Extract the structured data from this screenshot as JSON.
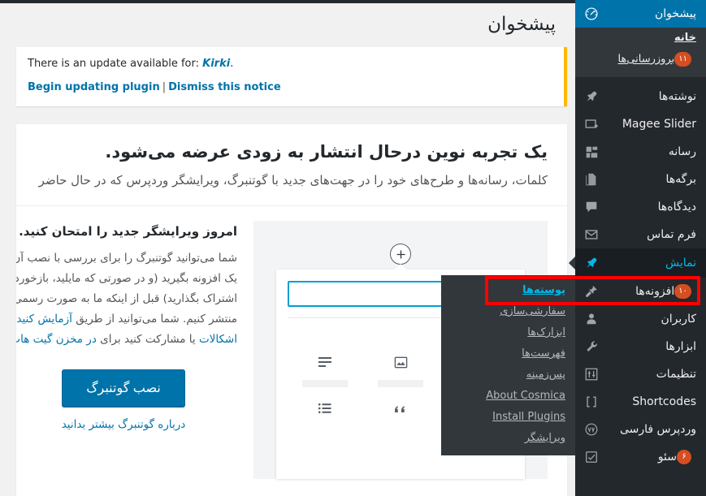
{
  "page": {
    "title": "پیشخوان",
    "language": "fa"
  },
  "colors": {
    "sidebar_bg": "#23282d",
    "submenu_bg": "#32373c",
    "accent_blue": "#0073aa",
    "link_blue": "#00b9eb",
    "badge_orange": "#d54e21",
    "notice_border": "#ffb900",
    "annotation_red": "#fe0000",
    "page_bg": "#f1f1f1"
  },
  "notice": {
    "message_prefix": "There is an update available for:",
    "plugin_name": "Kirki",
    "message_suffix": ".",
    "update_link": "Begin updating plugin",
    "separator": "|",
    "dismiss_link": "Dismiss this notice"
  },
  "panel": {
    "heading": "یک تجربه نوین درحال انتشار به زودی عرضه می‌شود.",
    "subheading": "کلمات، رسانه‌ها و طرح‌های خود را در جهت‌های جدید با گوتنبرگ، ویرایشگر وردپرس که در حال حاضر ",
    "column_title": "امروز ویرایشگر جدید را امتحان کنید.",
    "body_line1": "شما می‌توانید گوتنبرگ را برای بررسی با نصب آن",
    "body_line2": "یک افزونه بگیرید (و در صورتی که مایلید، بازخورد خ",
    "body_line3": "اشتراک بگذارید) قبل از اینکه ما به صورت رسمی آ",
    "body_line4_pre": "منتشر کنیم. شما می‌توانید از طریق ",
    "body_line4_link": "آزمایش کنید",
    "body_line5_link_a": "اشکالات",
    "body_line5_mid": " یا مشارکت کنید برای ",
    "body_line5_link_b": "در مخزن گیت هاب",
    "install_button": "نصب گوتنبرگ",
    "learn_more_link": "درباره گوتنبرگ بیشتر بدانید"
  },
  "illustration": {
    "add_block_icon": "plus-icon",
    "search_placeholder_bar": "",
    "section_title_bar": "",
    "blocks": [
      {
        "icon": "image-block-icon"
      },
      {
        "icon": "paragraph-block-icon"
      },
      {
        "icon": "third-block-icon"
      },
      {
        "icon": "quote-block-icon"
      },
      {
        "icon": "list-block-icon"
      },
      {
        "icon": "sixth-block-icon"
      }
    ]
  },
  "sidebar": {
    "dashboard": {
      "label": "پیشخوان",
      "icon": "dashboard-icon",
      "submenu": [
        {
          "label": "خانه",
          "badge": null
        },
        {
          "label": "بروزرسانی‌ها",
          "badge": "۱۱"
        }
      ]
    },
    "items": [
      {
        "label": "نوشته‌ها",
        "icon": "pin-icon",
        "badge": null,
        "state": "normal"
      },
      {
        "label": "Magee Slider",
        "icon": "slider-icon",
        "badge": null,
        "state": "normal"
      },
      {
        "label": "رسانه",
        "icon": "media-icon",
        "badge": null,
        "state": "normal"
      },
      {
        "label": "برگه‌ها",
        "icon": "pages-icon",
        "badge": null,
        "state": "normal"
      },
      {
        "label": "دیدگاه‌ها",
        "icon": "comments-icon",
        "badge": null,
        "state": "normal"
      },
      {
        "label": "فرم تماس",
        "icon": "mail-icon",
        "badge": null,
        "state": "normal"
      },
      {
        "label": "نمایش",
        "icon": "appearance-icon",
        "badge": null,
        "state": "open"
      },
      {
        "label": "افزونه‌ها",
        "icon": "plugins-icon",
        "badge": "۱۰",
        "state": "normal"
      },
      {
        "label": "کاربران",
        "icon": "users-icon",
        "badge": null,
        "state": "normal"
      },
      {
        "label": "ابزارها",
        "icon": "tools-icon",
        "badge": null,
        "state": "normal"
      },
      {
        "label": "تنظیمات",
        "icon": "settings-icon",
        "badge": null,
        "state": "normal"
      },
      {
        "label": "Shortcodes",
        "icon": "shortcodes-icon",
        "badge": null,
        "state": "normal"
      },
      {
        "label": "وردپرس فارسی",
        "icon": "wp-persian-icon",
        "badge": null,
        "state": "normal"
      },
      {
        "label": "سئو",
        "icon": "seo-icon",
        "badge": "۶",
        "state": "normal"
      }
    ]
  },
  "flyout": {
    "items": [
      {
        "label": "پوسته‌ها",
        "current": true
      },
      {
        "label": "سفارشی‌سازی",
        "current": false
      },
      {
        "label": "ابزارک‌ها",
        "current": false
      },
      {
        "label": "فهرست‌ها",
        "current": false
      },
      {
        "label": "پس‌زمینه",
        "current": false
      },
      {
        "label": "About Cosmica",
        "current": false
      },
      {
        "label": "Install Plugins",
        "current": false
      },
      {
        "label": "ویرایشگر",
        "current": false
      }
    ]
  }
}
